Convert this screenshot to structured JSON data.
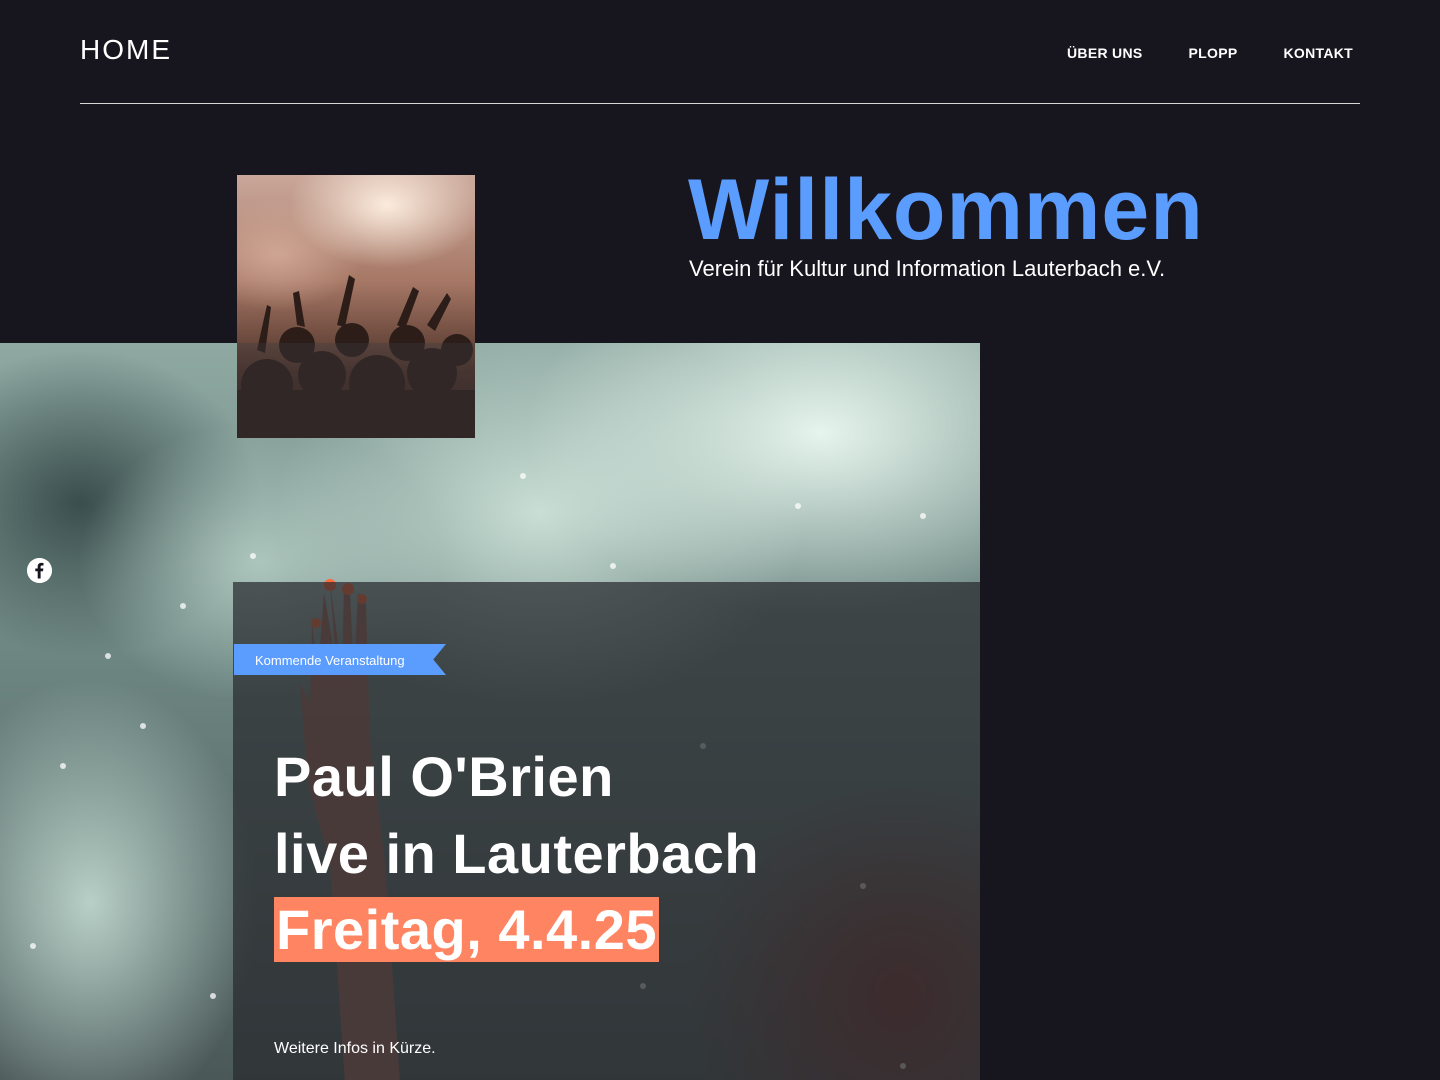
{
  "header": {
    "logo": "HOME",
    "nav": [
      "ÜBER UNS",
      "PLOPP",
      "KONTAKT"
    ]
  },
  "welcome": {
    "title": "Willkommen",
    "subtitle": "Verein für Kultur und Information Lauterbach e.V."
  },
  "event": {
    "tag": "Kommende Veranstaltung",
    "line1": "Paul O'Brien",
    "line2": "live in Lauterbach",
    "date": "Freitag, 4.4.25",
    "more": "Weitere Infos in Kürze."
  },
  "social": {
    "icon": "facebook-icon"
  },
  "colors": {
    "background": "#17161e",
    "accent_blue": "#5b9cff",
    "date_highlight": "#ff8461"
  }
}
